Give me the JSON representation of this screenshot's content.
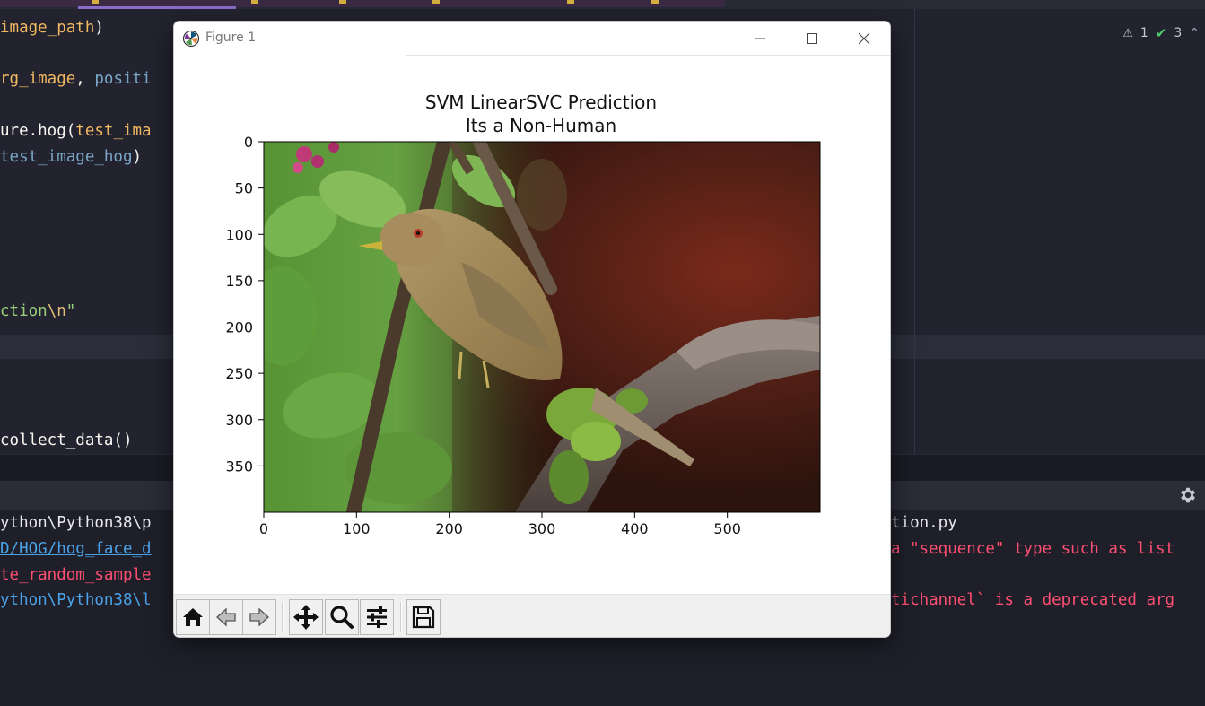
{
  "editor": {
    "lines": [
      {
        "parts": [
          {
            "t": "image_path",
            "c": "c-param"
          },
          {
            "t": ")",
            "c": "c-plain"
          }
        ]
      },
      {
        "parts": [
          {
            "t": "rg_image",
            "c": "c-param"
          },
          {
            "t": ", ",
            "c": "c-plain"
          },
          {
            "t": "positi",
            "c": "c-var"
          }
        ]
      },
      {
        "parts": [
          {
            "t": "ure.hog(",
            "c": "c-plain"
          },
          {
            "t": "test_ima",
            "c": "c-param"
          }
        ]
      },
      {
        "parts": [
          {
            "t": "test_image_hog",
            "c": "c-var"
          },
          {
            "t": ")",
            "c": "c-plain"
          }
        ]
      },
      {
        "parts": [
          {
            "t": "ction",
            "c": "c-str"
          },
          {
            "t": "\\n",
            "c": "c-esc"
          },
          {
            "t": "\"",
            "c": "c-str"
          }
        ]
      },
      {
        "parts": [
          {
            "t": "collect_data()",
            "c": "c-plain"
          }
        ]
      }
    ],
    "inspection": {
      "warnings": "1",
      "checks": "3"
    }
  },
  "console": {
    "lines": [
      {
        "left": "ython\\Python38\\p",
        "left_style": "con-plain",
        "right": "tion.py",
        "right_style": "con-plain"
      },
      {
        "left": "D/HOG/hog_face_d",
        "left_style": "con-link",
        "right": "a \"sequence\" type such as list",
        "right_style": "con-err"
      },
      {
        "left": "te_random_sample",
        "left_style": "con-err",
        "right": "",
        "right_style": "con-err"
      },
      {
        "left": "ython\\Python38\\l",
        "left_style": "con-link",
        "right": "tichannel` is a deprecated arg",
        "right_style": "con-err"
      }
    ]
  },
  "figure": {
    "window_title": "Figure 1",
    "window_buttons": [
      "minimize",
      "maximize",
      "close"
    ],
    "toolbar": [
      {
        "name": "home-icon",
        "tooltip": "Reset original view"
      },
      {
        "name": "back-arrow-icon",
        "tooltip": "Back to previous view"
      },
      {
        "name": "forward-arrow-icon",
        "tooltip": "Forward to next view"
      },
      {
        "name": "pan-icon",
        "tooltip": "Pan axes"
      },
      {
        "name": "zoom-icon",
        "tooltip": "Zoom to rectangle"
      },
      {
        "name": "configure-subplots-icon",
        "tooltip": "Configure subplots"
      },
      {
        "name": "save-icon",
        "tooltip": "Save the figure"
      }
    ]
  },
  "chart_data": {
    "type": "image",
    "title": "SVM LinearSVC Prediction",
    "subtitle": "Its a Non-Human",
    "image_content": "photograph of a brown thrush bird perched on a mossy branch",
    "image_size": [
      600,
      400
    ],
    "xticks": [
      0,
      100,
      200,
      300,
      400,
      500
    ],
    "yticks": [
      0,
      50,
      100,
      150,
      200,
      250,
      300,
      350
    ],
    "xlim": [
      0,
      600
    ],
    "ylim": [
      400,
      0
    ],
    "grid": false,
    "xlabel": "",
    "ylabel": ""
  }
}
